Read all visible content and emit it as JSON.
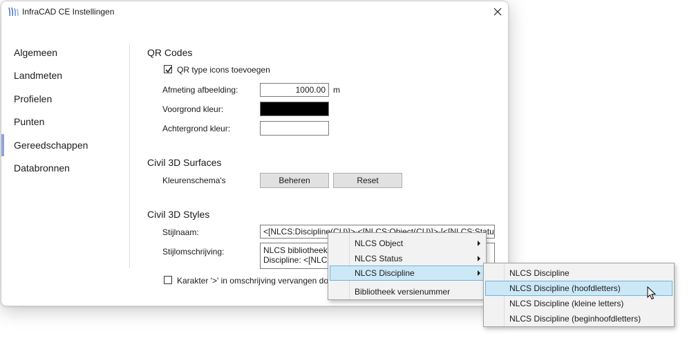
{
  "window": {
    "title": "InfraCAD CE Instellingen"
  },
  "nav": {
    "items": [
      "Algemeen",
      "Landmeten",
      "Profielen",
      "Punten",
      "Gereedschappen",
      "Databronnen"
    ],
    "selected": "Gereedschappen"
  },
  "qr": {
    "title": "QR Codes",
    "add_icons_label": "QR type icons toevoegen",
    "add_icons_checked": true,
    "size_label": "Afmeting afbeelding:",
    "size_value": "1000.00",
    "size_unit": "m",
    "fg_label": "Voorgrond kleur:",
    "fg_color": "#000000",
    "bg_label": "Achtergrond kleur:",
    "bg_color": "#ffffff"
  },
  "surfaces": {
    "title": "Civil 3D Surfaces",
    "scheme_label": "Kleurenschema's",
    "manage_button": "Beheren",
    "reset_button": "Reset"
  },
  "styles": {
    "title": "Civil 3D Styles",
    "name_label": "Stijlnaam:",
    "name_value": "<[NLCS:Discipline(CU)]>-<[NLCS:Object(CU)]>-[<[NLCS:Status(",
    "desc_label": "Stijlomschrijving:",
    "desc_line1": "NLCS bibliotheek:",
    "desc_line2": "Discipline: <[NLCS",
    "replace_label": "Karakter '>' in omschrijving vervangen do",
    "replace_checked": false
  },
  "context_menu": {
    "items": [
      {
        "label": "NLCS Object",
        "submenu": true
      },
      {
        "label": "NLCS Status",
        "submenu": true
      },
      {
        "label": "NLCS Discipline",
        "submenu": true,
        "highlighted": true
      },
      {
        "label": "Bibliotheek versienummer",
        "submenu": false
      }
    ]
  },
  "submenu": {
    "items": [
      {
        "label": "NLCS Discipline"
      },
      {
        "label": "NLCS Discipline (hoofdletters)",
        "highlighted": true
      },
      {
        "label": "NLCS Discipline (kleine letters)"
      },
      {
        "label": "NLCS Discipline (beginhoofdletters)"
      }
    ]
  },
  "colors": {
    "accent": "#8fa4d6",
    "highlight": "#cce8f7",
    "highlight_border": "#6fb3d9"
  }
}
